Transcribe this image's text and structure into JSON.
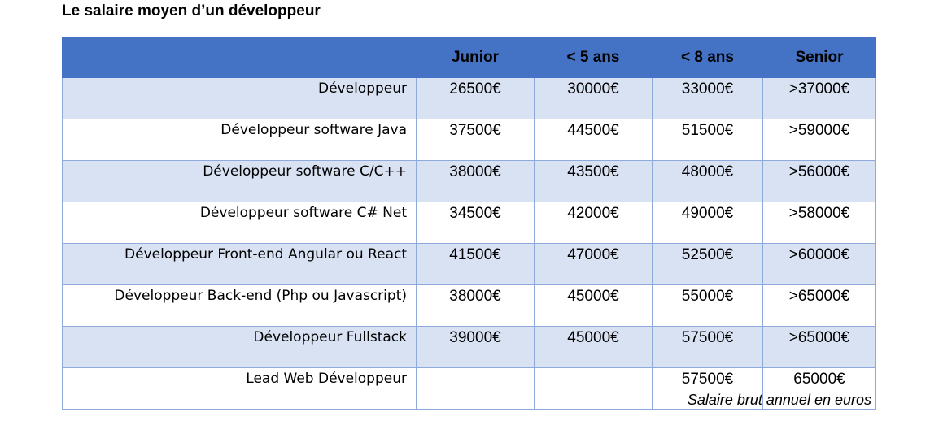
{
  "title": "Le salaire moyen d’un développeur",
  "table": {
    "headers": [
      "",
      "Junior",
      "< 5 ans",
      "< 8 ans",
      "Senior"
    ],
    "rows": [
      {
        "role": "Développeur",
        "values": [
          "26500€",
          "30000€",
          "33000€",
          ">37000€"
        ]
      },
      {
        "role": "Développeur software Java",
        "values": [
          "37500€",
          "44500€",
          "51500€",
          ">59000€"
        ]
      },
      {
        "role": "Développeur software C/C++",
        "values": [
          "38000€",
          "43500€",
          "48000€",
          ">56000€"
        ]
      },
      {
        "role": "Développeur software C# Net",
        "values": [
          "34500€",
          "42000€",
          "49000€",
          ">58000€"
        ]
      },
      {
        "role": "Développeur Front-end Angular ou React",
        "values": [
          "41500€",
          "47000€",
          "52500€",
          ">60000€"
        ]
      },
      {
        "role": "Développeur Back-end (Php ou Javascript)",
        "values": [
          "38000€",
          "45000€",
          "55000€",
          ">65000€"
        ]
      },
      {
        "role": "Développeur Fullstack",
        "values": [
          "39000€",
          "45000€",
          "57500€",
          ">65000€"
        ]
      },
      {
        "role": "Lead Web Développeur",
        "values": [
          "",
          "",
          "57500€",
          "65000€"
        ]
      }
    ]
  },
  "footnote": "Salaire brut annuel en euros",
  "colors": {
    "header": "#4472c4",
    "band": "#d9e2f3",
    "border": "#8eaadb"
  }
}
